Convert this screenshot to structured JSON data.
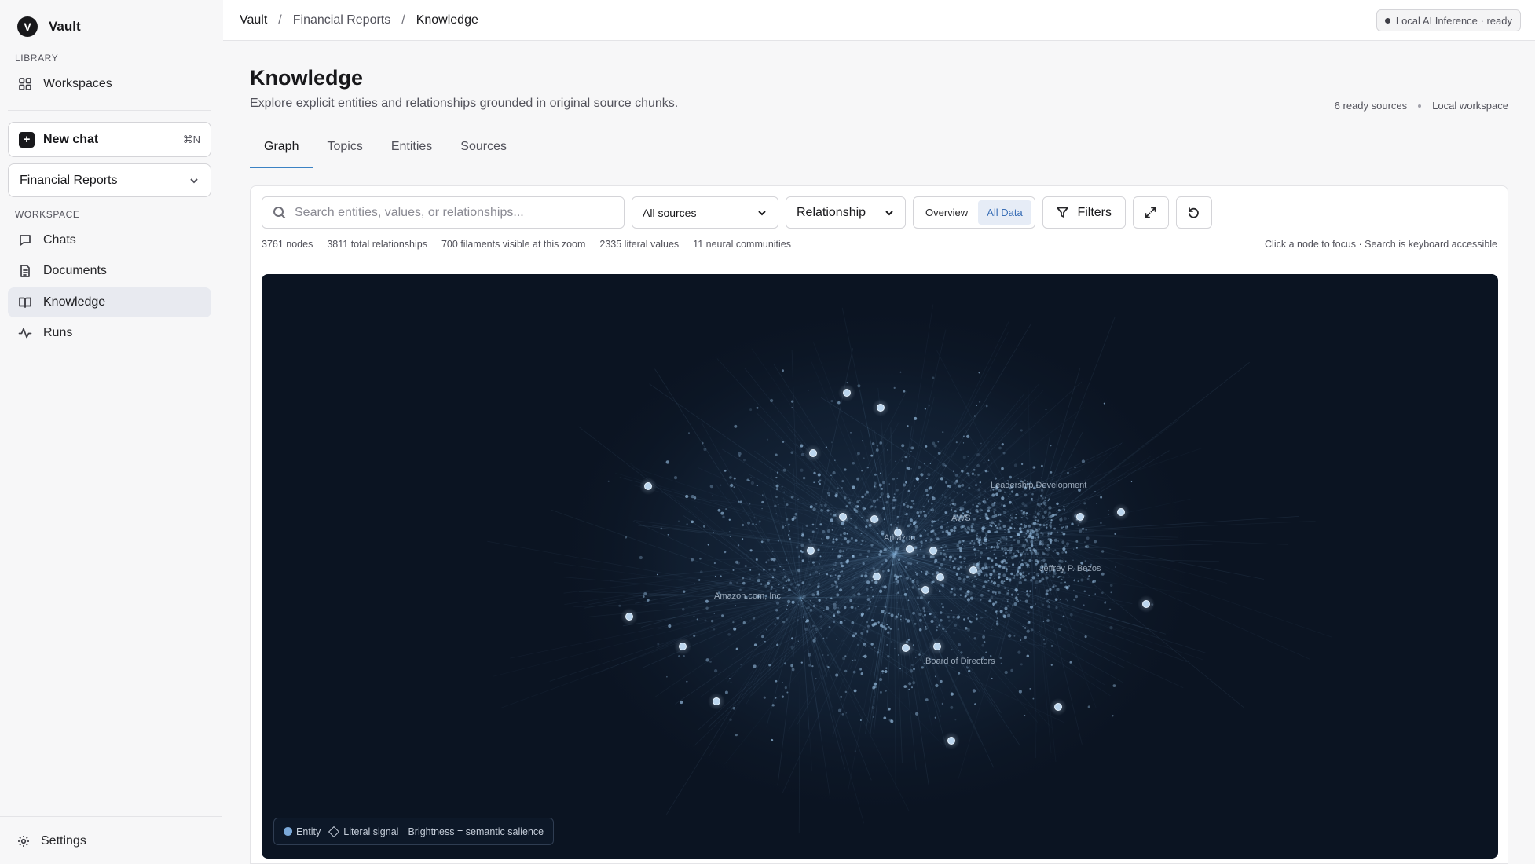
{
  "sidebar": {
    "brand": {
      "initial": "V",
      "name": "Vault"
    },
    "library_label": "LIBRARY",
    "library_items": [
      {
        "label": "Workspaces",
        "icon": "grid-icon"
      }
    ],
    "new_chat": {
      "label": "New chat",
      "shortcut": "⌘N"
    },
    "workspace_select": "Financial Reports",
    "workspace_label": "WORKSPACE",
    "workspace_items": [
      {
        "label": "Chats",
        "icon": "chat-icon"
      },
      {
        "label": "Documents",
        "icon": "document-icon"
      },
      {
        "label": "Knowledge",
        "icon": "book-icon",
        "active": true
      },
      {
        "label": "Runs",
        "icon": "activity-icon"
      }
    ],
    "settings_label": "Settings"
  },
  "topbar": {
    "breadcrumb": [
      "Vault",
      "Financial Reports",
      "Knowledge"
    ],
    "status": "Local AI Inference · ready"
  },
  "header": {
    "title": "Knowledge",
    "subtitle": "Explore explicit entities and relationships grounded in original source chunks.",
    "meta": [
      "6 ready sources",
      "Local workspace"
    ]
  },
  "tabs": [
    {
      "label": "Graph",
      "active": true
    },
    {
      "label": "Topics"
    },
    {
      "label": "Entities"
    },
    {
      "label": "Sources"
    }
  ],
  "toolbar": {
    "search_placeholder": "Search entities, values, or relationships...",
    "sources_select": "All sources",
    "mode_select": "Relationship",
    "view_options": [
      "Overview",
      "All Data"
    ],
    "view_selected": "All Data",
    "filters_label": "Filters"
  },
  "stats": {
    "nodes": "3761 nodes",
    "relationships": "3811 total relationships",
    "filaments": "700 filaments visible at this zoom",
    "literals": "2335 literal values",
    "communities": "11 neural communities"
  },
  "hint": "Click a node to focus · Search is keyboard accessible",
  "graph": {
    "labels": [
      "Leadership Development",
      "AWS",
      "Amazon",
      "Amazon.com, Inc.",
      "Jeffrey P. Bezos",
      "Board of Directors"
    ],
    "background": "#0b1422",
    "node_color": "#9cc3e6"
  },
  "legend": {
    "entity": "Entity",
    "literal": "Literal signal",
    "brightness": "Brightness = semantic salience"
  }
}
